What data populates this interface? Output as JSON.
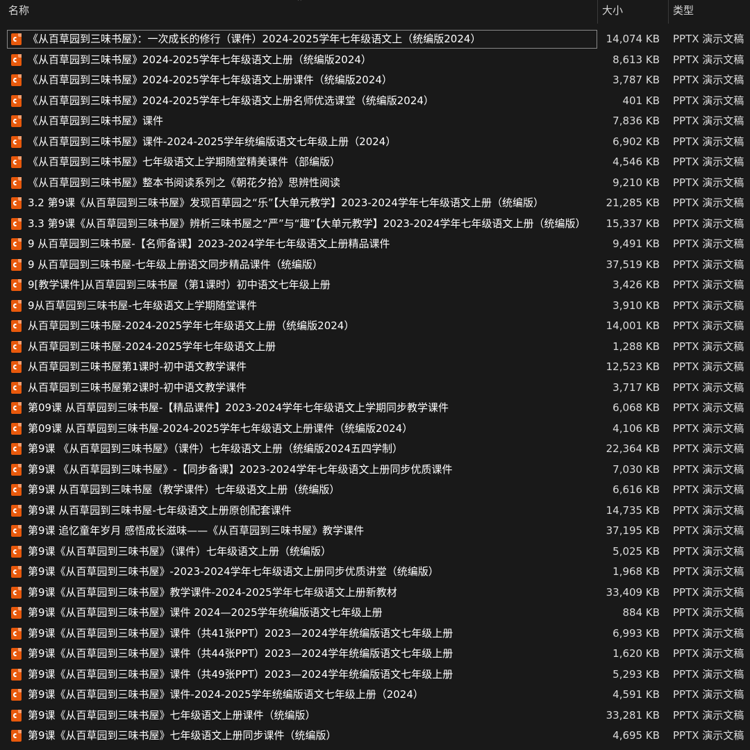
{
  "columns": {
    "name": "名称",
    "size": "大小",
    "type": "类型"
  },
  "colors": {
    "background": "#191919",
    "icon": "#e8590c",
    "text": "#ffffff"
  },
  "files": [
    {
      "name": "《从百草园到三味书屋》：一次成长的修行（课件）2024-2025学年七年级语文上（统编版2024）",
      "size": "14,074 KB",
      "type": "PPTX 演示文稿",
      "icon": "pptx-icon"
    },
    {
      "name": "《从百草园到三味书屋》2024-2025学年七年级语文上册（统编版2024）",
      "size": "8,613 KB",
      "type": "PPTX 演示文稿",
      "icon": "pptx-icon"
    },
    {
      "name": "《从百草园到三味书屋》2024-2025学年七年级语文上册课件（统编版2024）",
      "size": "3,787 KB",
      "type": "PPTX 演示文稿",
      "icon": "pptx-icon"
    },
    {
      "name": "《从百草园到三味书屋》2024-2025学年七年级语文上册名师优选课堂（统编版2024）",
      "size": "401 KB",
      "type": "PPTX 演示文稿",
      "icon": "pptx-icon"
    },
    {
      "name": "《从百草园到三味书屋》课件",
      "size": "7,836 KB",
      "type": "PPTX 演示文稿",
      "icon": "pptx-icon"
    },
    {
      "name": "《从百草园到三味书屋》课件-2024-2025学年统编版语文七年级上册（2024）",
      "size": "6,902 KB",
      "type": "PPTX 演示文稿",
      "icon": "pptx-icon"
    },
    {
      "name": "《从百草园到三味书屋》七年级语文上学期随堂精美课件（部编版）",
      "size": "4,546 KB",
      "type": "PPTX 演示文稿",
      "icon": "pptx-icon"
    },
    {
      "name": "《从百草园到三味书屋》整本书阅读系列之《朝花夕拾》思辨性阅读",
      "size": "9,210 KB",
      "type": "PPTX 演示文稿",
      "icon": "pptx-icon"
    },
    {
      "name": "3.2 第9课《从百草园到三味书屋》发现百草园之“乐”【大单元教学】2023-2024学年七年级语文上册（统编版）",
      "size": "21,285 KB",
      "type": "PPTX 演示文稿",
      "icon": "pptx-icon"
    },
    {
      "name": "3.3 第9课《从百草园到三味书屋》辨析三味书屋之“严”与“趣”【大单元教学】2023-2024学年七年级语文上册（统编版）",
      "size": "15,337 KB",
      "type": "PPTX 演示文稿",
      "icon": "pptx-icon"
    },
    {
      "name": "9 从百草园到三味书屋-【名师备课】2023-2024学年七年级语文上册精品课件",
      "size": "9,491 KB",
      "type": "PPTX 演示文稿",
      "icon": "pptx-icon"
    },
    {
      "name": "9 从百草园到三味书屋-七年级上册语文同步精品课件（统编版）",
      "size": "37,519 KB",
      "type": "PPTX 演示文稿",
      "icon": "pptx-icon"
    },
    {
      "name": "9[教学课件]从百草园到三味书屋（第1课时）初中语文七年级上册",
      "size": "3,426 KB",
      "type": "PPTX 演示文稿",
      "icon": "pptx-icon"
    },
    {
      "name": "9从百草园到三味书屋-七年级语文上学期随堂课件",
      "size": "3,910 KB",
      "type": "PPTX 演示文稿",
      "icon": "pptx-icon"
    },
    {
      "name": "从百草园到三味书屋-2024-2025学年七年级语文上册（统编版2024）",
      "size": "14,001 KB",
      "type": "PPTX 演示文稿",
      "icon": "pptx-icon"
    },
    {
      "name": "从百草园到三味书屋-2024-2025学年七年级语文上册",
      "size": "1,288 KB",
      "type": "PPTX 演示文稿",
      "icon": "pptx-icon"
    },
    {
      "name": "从百草园到三味书屋第1课时-初中语文教学课件",
      "size": "12,523 KB",
      "type": "PPTX 演示文稿",
      "icon": "pptx-icon"
    },
    {
      "name": "从百草园到三味书屋第2课时-初中语文教学课件",
      "size": "3,717 KB",
      "type": "PPTX 演示文稿",
      "icon": "pptx-icon"
    },
    {
      "name": "第09课 从百草园到三味书屋-【精品课件】2023-2024学年七年级语文上学期同步教学课件",
      "size": "6,068 KB",
      "type": "PPTX 演示文稿",
      "icon": "pptx-icon"
    },
    {
      "name": "第09课 从百草园到三味书屋-2024-2025学年七年级语文上册课件（统编版2024）",
      "size": "4,106 KB",
      "type": "PPTX 演示文稿",
      "icon": "pptx-icon"
    },
    {
      "name": "第9课 《从百草园到三味书屋》（课件）七年级语文上册（统编版2024五四学制）",
      "size": "22,364 KB",
      "type": "PPTX 演示文稿",
      "icon": "pptx-icon"
    },
    {
      "name": "第9课 《从百草园到三味书屋》-【同步备课】2023-2024学年七年级语文上册同步优质课件",
      "size": "7,030 KB",
      "type": "PPTX 演示文稿",
      "icon": "pptx-icon"
    },
    {
      "name": "第9课 从百草园到三味书屋（教学课件）七年级语文上册（统编版）",
      "size": "6,616 KB",
      "type": "PPTX 演示文稿",
      "icon": "pptx-icon"
    },
    {
      "name": "第9课 从百草园到三味书屋-七年级语文上册原创配套课件",
      "size": "14,735 KB",
      "type": "PPTX 演示文稿",
      "icon": "pptx-icon"
    },
    {
      "name": "第9课 追忆童年岁月 感悟成长滋味——《从百草园到三味书屋》教学课件",
      "size": "37,195 KB",
      "type": "PPTX 演示文稿",
      "icon": "pptx-icon"
    },
    {
      "name": "第9课《从百草园到三味书屋》（课件）七年级语文上册（统编版）",
      "size": "5,025 KB",
      "type": "PPTX 演示文稿",
      "icon": "pptx-icon"
    },
    {
      "name": "第9课《从百草园到三味书屋》-2023-2024学年七年级语文上册同步优质讲堂（统编版）",
      "size": "1,968 KB",
      "type": "PPTX 演示文稿",
      "icon": "pptx-icon"
    },
    {
      "name": "第9课《从百草园到三味书屋》教学课件-2024-2025学年七年级语文上册新教材",
      "size": "33,409 KB",
      "type": "PPTX 演示文稿",
      "icon": "pptx-icon"
    },
    {
      "name": "第9课《从百草园到三味书屋》课件 2024—2025学年统编版语文七年级上册",
      "size": "884 KB",
      "type": "PPTX 演示文稿",
      "icon": "pptx-icon"
    },
    {
      "name": "第9课《从百草园到三味书屋》课件（共41张PPT）2023—2024学年统编版语文七年级上册",
      "size": "6,993 KB",
      "type": "PPTX 演示文稿",
      "icon": "pptx-icon"
    },
    {
      "name": "第9课《从百草园到三味书屋》课件（共44张PPT）2023—2024学年统编版语文七年级上册",
      "size": "1,620 KB",
      "type": "PPTX 演示文稿",
      "icon": "pptx-icon"
    },
    {
      "name": "第9课《从百草园到三味书屋》课件（共49张PPT）2023—2024学年统编版语文七年级上册",
      "size": "5,293 KB",
      "type": "PPTX 演示文稿",
      "icon": "pptx-icon"
    },
    {
      "name": "第9课《从百草园到三味书屋》课件-2024-2025学年统编版语文七年级上册（2024）",
      "size": "4,591 KB",
      "type": "PPTX 演示文稿",
      "icon": "pptx-icon"
    },
    {
      "name": "第9课《从百草园到三味书屋》七年级语文上册课件（统编版）",
      "size": "33,281 KB",
      "type": "PPTX 演示文稿",
      "icon": "pptx-icon"
    },
    {
      "name": "第9课《从百草园到三味书屋》七年级语文上册同步课件（统编版）",
      "size": "4,695 KB",
      "type": "PPTX 演示文稿",
      "icon": "pptx-icon"
    }
  ]
}
